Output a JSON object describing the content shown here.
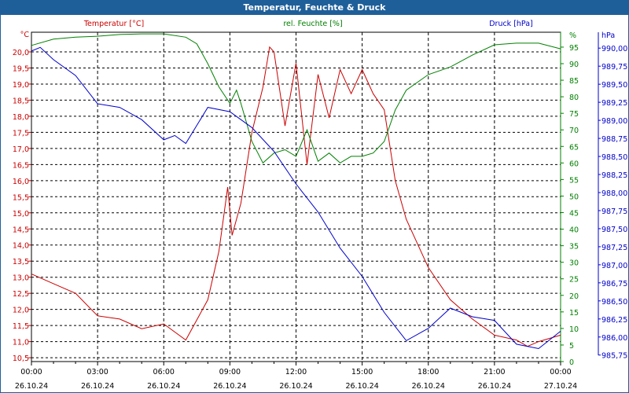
{
  "window": {
    "title": "Temperatur, Feuchte & Druck"
  },
  "colors": {
    "temperature": "#cc0000",
    "humidity": "#008000",
    "pressure": "#0000cc",
    "titlebar": "#1f5f99"
  },
  "chart_data": {
    "type": "line",
    "title": "Temperatur, Feuchte & Druck",
    "legend": [
      "Temperatur [°C]",
      "rel. Feuchte [%]",
      "Druck [hPa]"
    ],
    "axes": {
      "temperature": {
        "unit": "°C",
        "range": [
          10.38,
          20.61
        ],
        "ticks": [
          "10,5",
          "11,0",
          "11,5",
          "12,0",
          "12,5",
          "13,0",
          "13,5",
          "14,0",
          "14,5",
          "15,0",
          "15,5",
          "16,0",
          "16,5",
          "17,0",
          "17,5",
          "18,0",
          "18,5",
          "19,0",
          "19,5",
          "20,0"
        ]
      },
      "humidity": {
        "unit": "%",
        "range": [
          0,
          99.5
        ],
        "ticks": [
          "0",
          "5",
          "10",
          "15",
          "20",
          "25",
          "30",
          "35",
          "40",
          "45",
          "50",
          "55",
          "60",
          "65",
          "70",
          "75",
          "80",
          "85",
          "90",
          "95"
        ]
      },
      "pressure": {
        "unit": "hPa",
        "range": [
          985.66,
          990.22
        ],
        "ticks": [
          "985,75",
          "986,00",
          "986,25",
          "986,50",
          "986,75",
          "987,00",
          "987,25",
          "987,50",
          "987,75",
          "988,00",
          "988,25",
          "988,50",
          "988,75",
          "989,00",
          "989,25",
          "989,50",
          "989,75",
          "990,00"
        ]
      },
      "x": {
        "range_hours": [
          0,
          24
        ],
        "ticks": [
          {
            "time": "00:00",
            "date": "26.10.24"
          },
          {
            "time": "03:00",
            "date": "26.10.24"
          },
          {
            "time": "06:00",
            "date": "26.10.24"
          },
          {
            "time": "09:00",
            "date": "26.10.24"
          },
          {
            "time": "12:00",
            "date": "26.10.24"
          },
          {
            "time": "15:00",
            "date": "26.10.24"
          },
          {
            "time": "18:00",
            "date": "26.10.24"
          },
          {
            "time": "21:00",
            "date": "26.10.24"
          },
          {
            "time": "00:00",
            "date": "27.10.24"
          }
        ]
      }
    },
    "grid": true,
    "series": [
      {
        "name": "Temperatur [°C]",
        "axis": "temperature",
        "x": [
          0,
          1,
          2,
          3,
          4,
          5,
          6,
          7,
          8,
          8.5,
          8.9,
          9.1,
          9.5,
          10,
          10.5,
          10.8,
          11,
          11.5,
          12,
          12.5,
          13,
          13.5,
          14,
          14.5,
          15,
          15.5,
          16,
          16.5,
          17,
          18,
          19,
          20,
          21,
          22,
          22.5,
          23,
          24
        ],
        "y": [
          13.1,
          12.8,
          12.5,
          11.8,
          11.7,
          11.4,
          11.55,
          11.05,
          12.3,
          13.8,
          15.8,
          14.3,
          15.3,
          17.5,
          18.9,
          20.15,
          20.0,
          17.7,
          19.65,
          16.5,
          19.3,
          17.95,
          19.45,
          18.7,
          19.45,
          18.7,
          18.2,
          16.0,
          14.8,
          13.3,
          12.3,
          11.7,
          11.2,
          11.05,
          10.85,
          11.0,
          11.2
        ]
      },
      {
        "name": "rel. Feuchte [%]",
        "axis": "humidity",
        "x": [
          0,
          1,
          2,
          3,
          4,
          5,
          6,
          7,
          7.5,
          8,
          8.5,
          9,
          9.3,
          9.5,
          10,
          10.5,
          11,
          11.5,
          12,
          12.5,
          13,
          13.5,
          14,
          14.5,
          15,
          15.5,
          16,
          16.5,
          17,
          18,
          19,
          20,
          21,
          22,
          23,
          24
        ],
        "y": [
          95.5,
          97.4,
          98,
          98.3,
          98.8,
          99,
          99,
          98,
          96,
          90,
          83,
          78,
          82,
          78,
          66.5,
          60,
          63,
          64,
          62,
          70,
          60.5,
          63,
          60,
          62,
          62,
          63,
          66.5,
          76,
          82,
          86.7,
          89,
          92.6,
          95.7,
          96.2,
          96.2,
          94.5
        ]
      },
      {
        "name": "Druck [hPa]",
        "axis": "pressure",
        "x": [
          0,
          0.4,
          1,
          2,
          3,
          4,
          5,
          6,
          6.5,
          7,
          8,
          9,
          10,
          11,
          12,
          13,
          14,
          15,
          16,
          17,
          18,
          19,
          20,
          21,
          22,
          23,
          24
        ],
        "y": [
          989.96,
          990.01,
          989.84,
          989.62,
          989.23,
          989.18,
          989.01,
          988.73,
          988.79,
          988.68,
          989.18,
          989.12,
          988.9,
          988.57,
          988.12,
          987.73,
          987.23,
          986.84,
          986.34,
          985.95,
          986.12,
          986.4,
          986.28,
          986.23,
          985.9,
          985.84,
          986.08
        ]
      }
    ]
  }
}
